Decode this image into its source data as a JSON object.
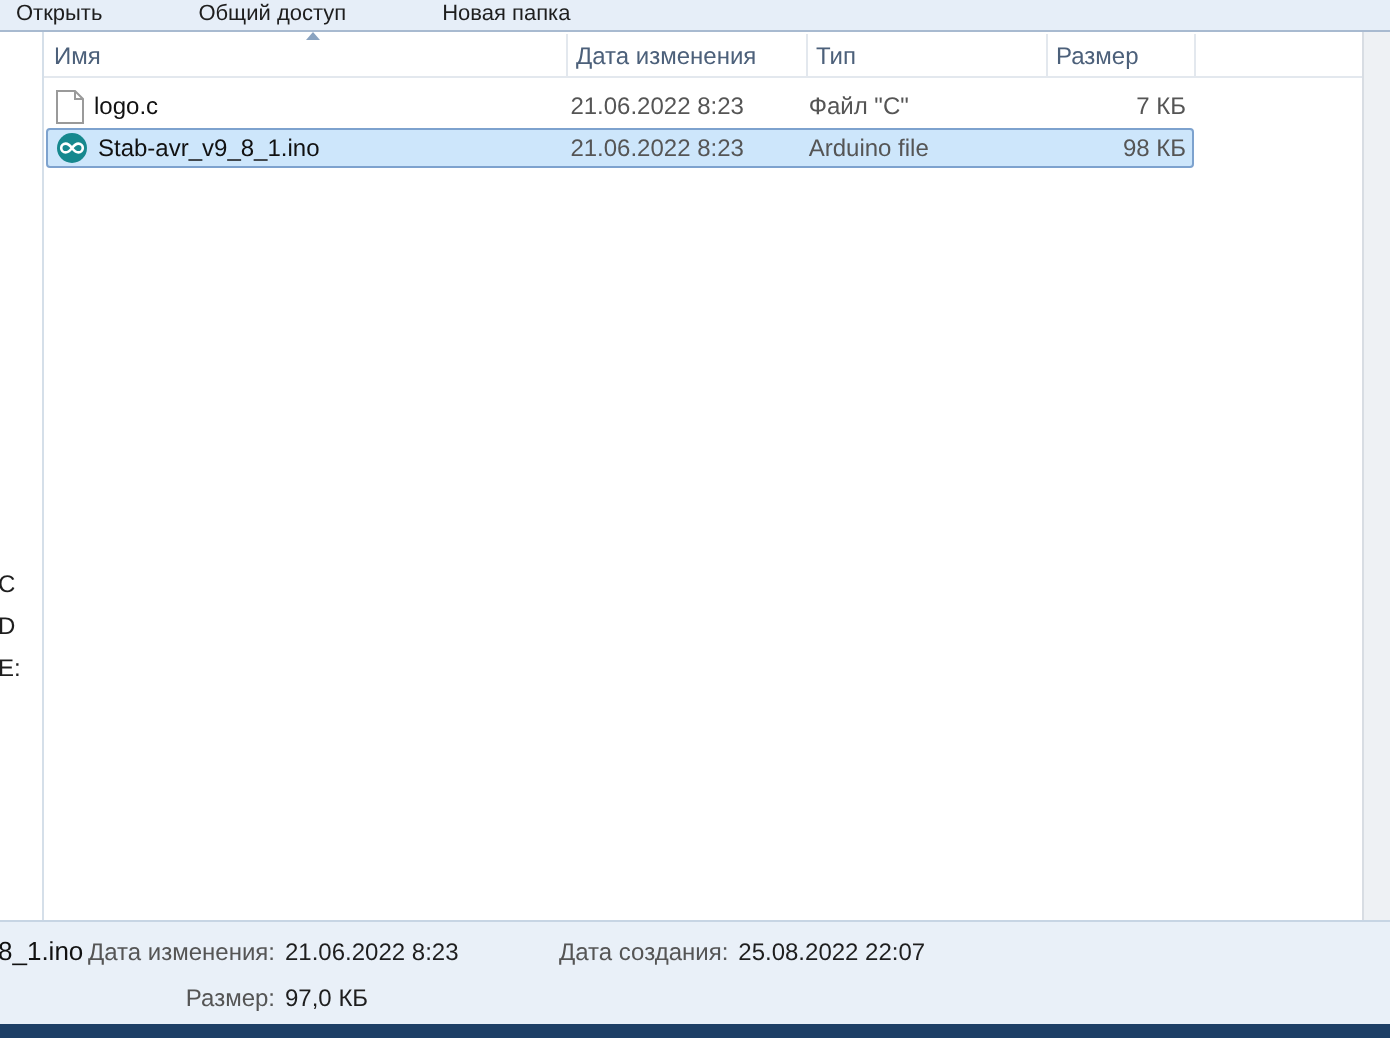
{
  "toolbar": {
    "buttons": [
      "Открыть",
      "Общий доступ",
      "Новая папка"
    ]
  },
  "nav_pane": {
    "items": [
      "C",
      "D",
      "E:"
    ]
  },
  "file_list": {
    "columns": [
      {
        "label": "Имя",
        "sorted": true
      },
      {
        "label": "Дата изменения",
        "sorted": false
      },
      {
        "label": "Тип",
        "sorted": false
      },
      {
        "label": "Размер",
        "sorted": false
      }
    ],
    "rows": [
      {
        "kind": "text",
        "name": "logo.c",
        "modified": "21.06.2022 8:23",
        "type": "Файл \"C\"",
        "size": "7 КБ",
        "selected": false
      },
      {
        "kind": "arduino",
        "name": "Stab-avr_v9_8_1.ino",
        "modified": "21.06.2022 8:23",
        "type": "Arduino file",
        "size": "98 КБ",
        "selected": true
      }
    ]
  },
  "details_pane": {
    "name": "8_1.ino",
    "fields": [
      {
        "label": "Дата изменения:",
        "value": "21.06.2022 8:23"
      },
      {
        "label": "Дата создания:",
        "value": "25.08.2022 22:07"
      },
      {
        "label": "Размер:",
        "value": "97,0 КБ"
      }
    ]
  }
}
